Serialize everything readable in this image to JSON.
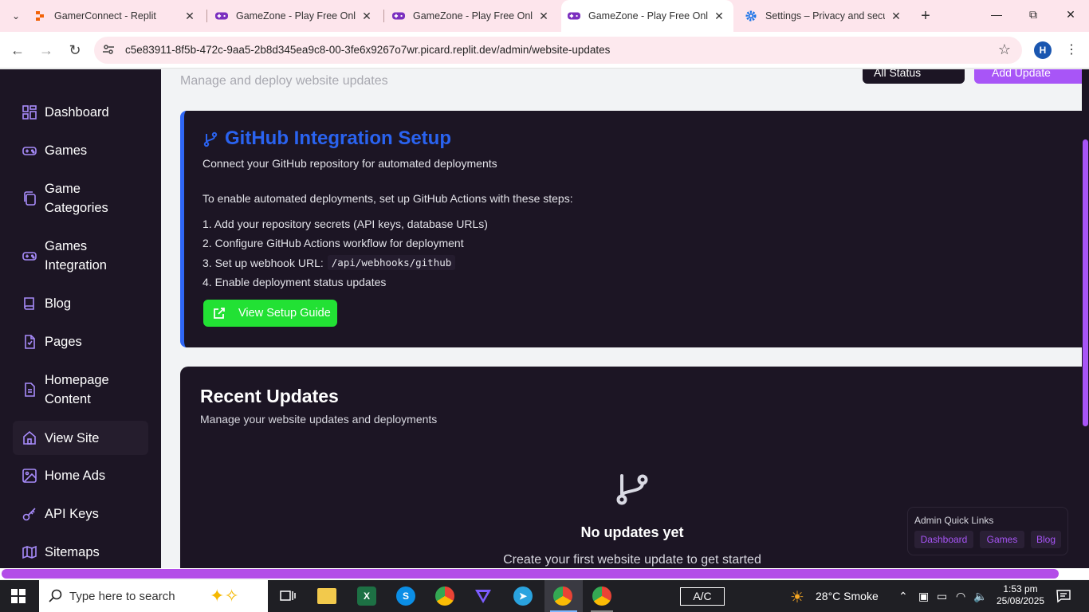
{
  "browser": {
    "tabs": [
      {
        "title": "GamerConnect - Replit",
        "favicon": "replit-icon"
      },
      {
        "title": "GameZone - Play Free Online",
        "favicon": "gamepad-icon"
      },
      {
        "title": "GameZone - Play Free Online",
        "favicon": "gamepad-icon"
      },
      {
        "title": "GameZone - Play Free Online",
        "favicon": "gamepad-icon"
      },
      {
        "title": "Settings – Privacy and security",
        "favicon": "gear-icon"
      }
    ],
    "active_tab_index": 3,
    "url": "c5e83911-8f5b-472c-9aa5-2b8d345ea9c8-00-3fe6x9267o7wr.picard.replit.dev/admin/website-updates",
    "profile_initial": "H"
  },
  "sidebar": {
    "items": [
      {
        "label": "Dashboard",
        "icon": "dashboard-icon"
      },
      {
        "label": "Games",
        "icon": "gamepad-icon"
      },
      {
        "label": "Game Categories",
        "icon": "copy-icon"
      },
      {
        "label": "Games Integration",
        "icon": "gamepad-icon"
      },
      {
        "label": "Blog",
        "icon": "book-icon"
      },
      {
        "label": "Pages",
        "icon": "file-icon"
      },
      {
        "label": "Homepage Content",
        "icon": "document-icon"
      },
      {
        "label": "View Site",
        "icon": "home-icon"
      },
      {
        "label": "Home Ads",
        "icon": "image-icon"
      },
      {
        "label": "API Keys",
        "icon": "key-icon"
      },
      {
        "label": "Sitemaps",
        "icon": "map-icon"
      }
    ],
    "active_index": 7
  },
  "header": {
    "subtitle": "Manage and deploy website updates",
    "status_filter": "All Status",
    "add_button": "Add Update"
  },
  "github": {
    "title": "GitHub Integration Setup",
    "subtitle": "Connect your GitHub repository for automated deployments",
    "intro": "To enable automated deployments, set up GitHub Actions with these steps:",
    "steps": [
      "1. Add your repository secrets (API keys, database URLs)",
      "2. Configure GitHub Actions workflow for deployment",
      "3. Set up webhook URL:",
      "4. Enable deployment status updates"
    ],
    "webhook_code": "/api/webhooks/github",
    "button": "View Setup Guide"
  },
  "recent": {
    "title": "Recent Updates",
    "subtitle": "Manage your website updates and deployments",
    "empty_title": "No updates yet",
    "empty_subtitle": "Create your first website update to get started"
  },
  "quick_links": {
    "title": "Admin Quick Links",
    "links": [
      "Dashboard",
      "Games",
      "Blog"
    ]
  },
  "taskbar": {
    "search_placeholder": "Type here to search",
    "battery": "A/C",
    "weather": "28°C  Smoke",
    "time": "1:53 pm",
    "date": "25/08/2025"
  },
  "colors": {
    "sidebar_bg": "#1c1524",
    "accent_purple": "#a855f7",
    "github_blue": "#2a63f0",
    "setup_green": "#22e134"
  }
}
